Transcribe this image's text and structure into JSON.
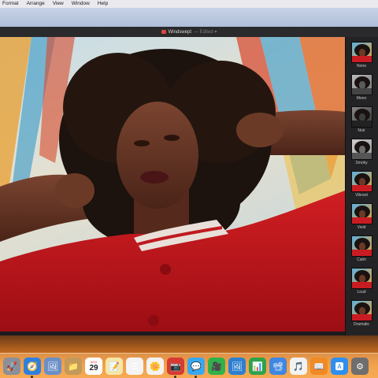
{
  "menubar": {
    "items": [
      "Format",
      "Arrange",
      "View",
      "Window",
      "Help"
    ]
  },
  "window": {
    "title": "Windswept",
    "subtitle": "— Edited ▾"
  },
  "filters": [
    {
      "label": "None",
      "tone": "color"
    },
    {
      "label": "Mono",
      "tone": "mono"
    },
    {
      "label": "Noir",
      "tone": "noir"
    },
    {
      "label": "Smoky",
      "tone": "smoky"
    },
    {
      "label": "Vibrant",
      "tone": "color"
    },
    {
      "label": "Vivid",
      "tone": "color"
    },
    {
      "label": "Calm",
      "tone": "color"
    },
    {
      "label": "Loud",
      "tone": "color"
    },
    {
      "label": "Dramatic",
      "tone": "color"
    }
  ],
  "dock": {
    "calendar_day": "29",
    "calendar_month": "NOV",
    "apps": [
      {
        "name": "launchpad-icon",
        "color": "#8a8f99",
        "glyph": "🚀"
      },
      {
        "name": "safari-icon",
        "color": "#2f7fe0",
        "glyph": "🧭"
      },
      {
        "name": "photos-app-icon",
        "color": "#6b8fc7",
        "glyph": "🖼"
      },
      {
        "name": "notes-app-icon",
        "color": "#c39a5a",
        "glyph": "📁"
      },
      {
        "name": "calendar-icon",
        "color": "#ffffff",
        "glyph": ""
      },
      {
        "name": "notes-icon",
        "color": "#f6e7a8",
        "glyph": "📝"
      },
      {
        "name": "reminders-icon",
        "color": "#f4f4f4",
        "glyph": "☰"
      },
      {
        "name": "photos-icon",
        "color": "#f2f2f2",
        "glyph": "🌼"
      },
      {
        "name": "photo-booth-icon",
        "color": "#d63b32",
        "glyph": "📷"
      },
      {
        "name": "messages-icon",
        "color": "#38a7f0",
        "glyph": "💬"
      },
      {
        "name": "facetime-icon",
        "color": "#2fb24a",
        "glyph": "🎥"
      },
      {
        "name": "keynote-icon",
        "color": "#2d7fd0",
        "glyph": "🖼"
      },
      {
        "name": "numbers-icon",
        "color": "#2fa34a",
        "glyph": "📊"
      },
      {
        "name": "keynote-presentation-icon",
        "color": "#3f87e0",
        "glyph": "📽"
      },
      {
        "name": "music-icon",
        "color": "#f2f2f2",
        "glyph": "🎵"
      },
      {
        "name": "books-icon",
        "color": "#f08a24",
        "glyph": "📖"
      },
      {
        "name": "app-store-icon",
        "color": "#2f8ff0",
        "glyph": "🅰"
      },
      {
        "name": "system-preferences-icon",
        "color": "#6e6e6e",
        "glyph": "⚙"
      }
    ]
  }
}
